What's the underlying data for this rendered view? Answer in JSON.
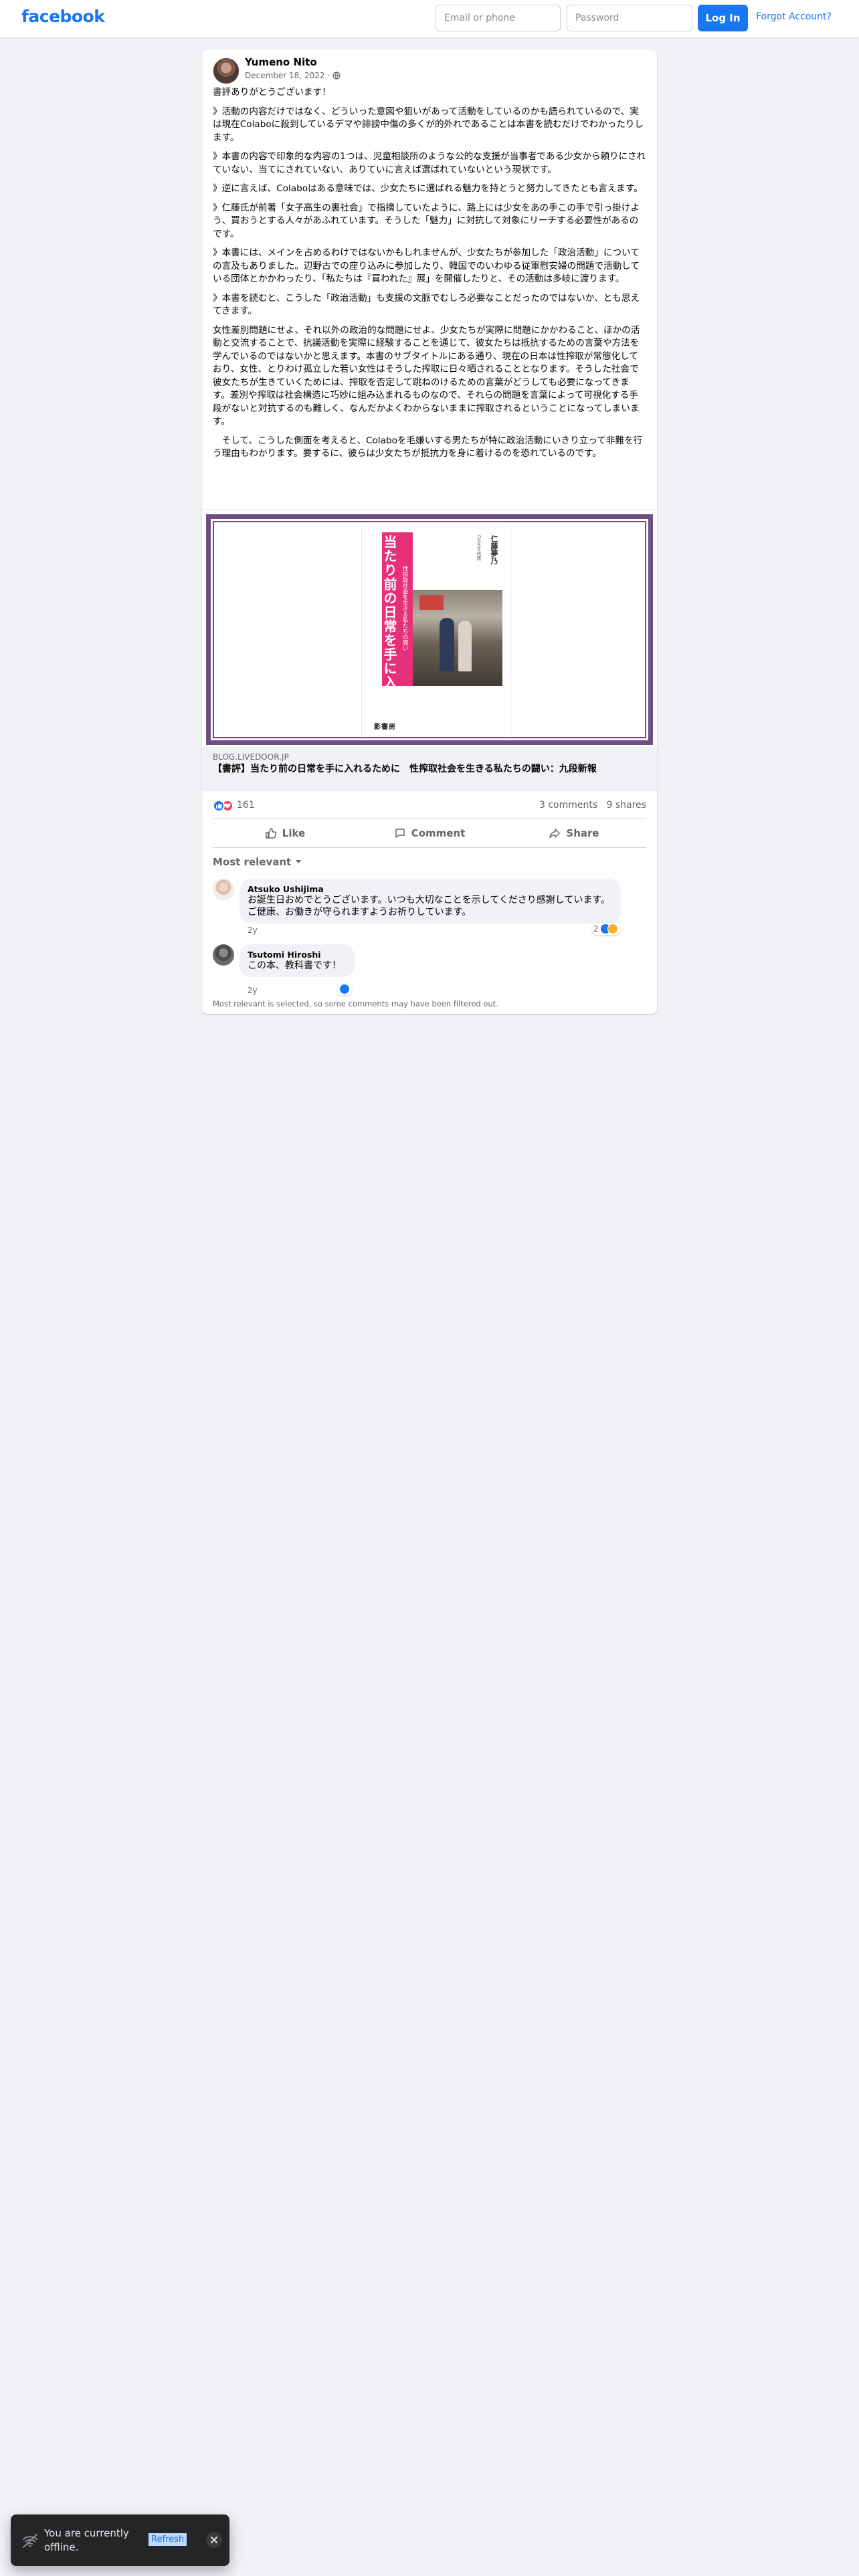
{
  "header": {
    "logo": "facebook",
    "email_placeholder": "Email or phone",
    "password_placeholder": "Password",
    "login_label": "Log In",
    "forgot_label": "Forgot Account?"
  },
  "post": {
    "author": "Yumeno Nito",
    "date": "December 18, 2022",
    "separator": "·",
    "paragraphs": [
      "書評ありがとうございます！",
      "》活動の内容だけではなく、どういった意図や狙いがあって活動をしているのかも語られているので、実は現在Colaboに殺到しているデマや誹謗中傷の多くが的外れであることは本書を読むだけでわかったりします。",
      "》本書の内容で印象的な内容の1つは、児童相談所のような公的な支援が当事者である少女から頼りにされていない、当てにされていない、ありていに言えば選ばれていないという現状です。",
      "》逆に言えば、Colaboはある意味では、少女たちに選ばれる魅力を持とうと努力してきたとも言えます。",
      "》仁藤氏が前著「女子高生の裏社会」で指摘していたように、路上には少女をあの手この手で引っ掛けよう、買おうとする人々があふれています。そうした「魅力」に対抗して対象にリーチする必要性があるのです。",
      "》本書には、メインを占めるわけではないかもしれませんが、少女たちが参加した「政治活動」についての言及もありました。辺野古での座り込みに参加したり、韓国でのいわゆる従軍慰安婦の問題で活動している団体とかかわったり、「私たちは『買われた』展」を開催したりと、その活動は多岐に渡ります。",
      "》本書を読むと、こうした「政治活動」も支援の文脈でむしろ必要なことだったのではないか、とも思えてきます。",
      "女性差別問題にせよ、それ以外の政治的な問題にせよ、少女たちが実際に問題にかかわること、ほかの活動と交流することで、抗議活動を実際に経験することを通じて、彼女たちは抵抗するための言葉や方法を学んでいるのではないかと思えます。本書のサブタイトルにある通り、現在の日本は性搾取が常態化しており、女性、とりわけ孤立した若い女性はそうした搾取に日々晒されることとなります。そうした社会で彼女たちが生きていくためには、搾取を否定して跳ねのけるための言葉がどうしても必要になってきます。差別や搾取は社会構造に巧妙に組み込まれるものなので、それらの問題を言葉によって可視化する手段がないと対抗するのも難しく、なんだかよくわからないままに搾取されるということになってしまいます。",
      "　そして、こうした側面を考えると、Colaboを毛嫌いする男たちが特に政治活動にいきり立って非難を行う理由もわかります。要するに、彼らは少女たちが抵抗力を身に着けるのを恐れているのです。"
    ],
    "link": {
      "domain": "blog.livedoor.jp",
      "title": "【書評】当たり前の日常を手に入れるために　性搾取社会を生きる私たちの闘い：九段新報"
    },
    "book_cover": {
      "title": "当たり前の日常を手に入れるために",
      "subtitle": "性搾取社会を生きる私たちの闘い",
      "author": "仁藤夢乃",
      "label": "Colabo代表",
      "publisher": "影書房"
    },
    "reactions": {
      "count": "161",
      "comments": "3 comments",
      "shares": "9 shares",
      "like_color": "#1877f2",
      "love_color": "#f33e58"
    },
    "actions": {
      "like": "Like",
      "comment": "Comment",
      "share": "Share"
    },
    "sort_label": "Most relevant",
    "comments": [
      {
        "author": "Atsuko Ushijima",
        "text": "お誕生日おめでとうございます。いつも大切なことを示してくださり感謝しています。ご健康、お働きが守られますようお祈りしています。",
        "time": "2y",
        "reaction_count": "2"
      },
      {
        "author": "Tsutomi Hiroshi",
        "text": "この本、教科書です！",
        "time": "2y"
      }
    ],
    "filter_note": "Most relevant is selected, so some comments may have been filtered out."
  },
  "toast": {
    "message": "You are currently offline.",
    "refresh_label": "Refresh"
  }
}
